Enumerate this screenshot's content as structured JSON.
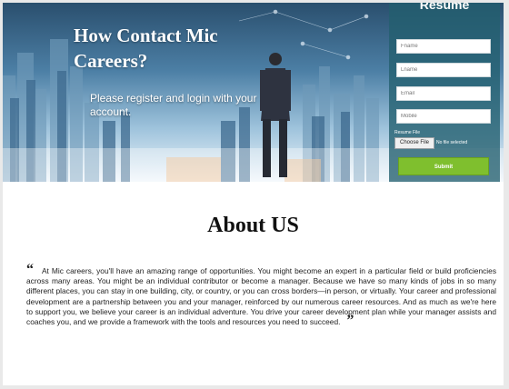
{
  "hero": {
    "title": "How Contact Mic Careers?",
    "subtitle": "Please register and login with your account."
  },
  "resume": {
    "title": "Resume",
    "fields": [
      {
        "placeholder": "Fname"
      },
      {
        "placeholder": "Lname"
      },
      {
        "placeholder": "Email"
      },
      {
        "placeholder": "Mobile"
      }
    ],
    "upload_label": "Resume File",
    "choose_button": "Choose File",
    "no_file_text": "No file selected",
    "submit_label": "Submit"
  },
  "about": {
    "title": "About US",
    "open_quote": "“",
    "close_quote": "”",
    "text": "At Mic careers, you'll have an amazing range of opportunities. You might become an expert in a particular field or build proficiencies across many areas. You might be an individual contributor or become a manager. Because we have so many kinds of jobs in so many different places, you can stay in one building, city, or country, or you can cross borders—in person, or virtually. Your career and professional development are a partnership between you and your manager, reinforced by our numerous career resources. And as much as we're here to support you, we believe your career is an individual adventure. You drive your career development plan while your manager assists and coaches you, and we provide a framework with the tools and resources you need to succeed."
  },
  "colors": {
    "panel": "#235f6e",
    "submit": "#7fbf2e"
  }
}
